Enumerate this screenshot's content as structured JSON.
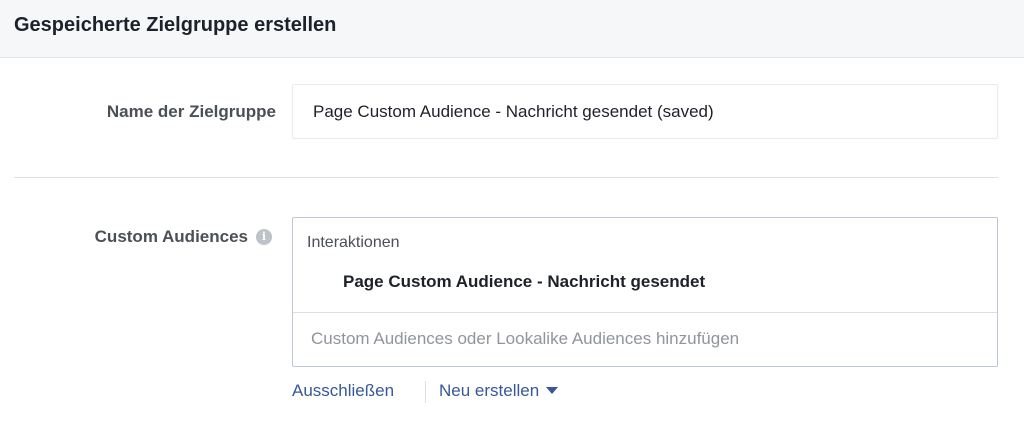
{
  "header": {
    "title": "Gespeicherte Zielgruppe erstellen"
  },
  "form": {
    "name_label": "Name der Zielgruppe",
    "name_value": "Page Custom Audience - Nachricht gesendet (saved)",
    "custom_audiences_label": "Custom Audiences",
    "info_icon": "info-icon",
    "group_title": "Interaktionen",
    "selected_audience": "Page Custom Audience - Nachricht gesendet",
    "search_placeholder": "Custom Audiences oder Lookalike Audiences hinzufügen"
  },
  "actions": {
    "exclude_label": "Ausschließen",
    "create_label": "Neu erstellen",
    "create_icon": "caret-down-icon"
  },
  "colors": {
    "link": "#365899",
    "header_bg": "#f6f7f9",
    "box_border": "#bdc7d8"
  }
}
